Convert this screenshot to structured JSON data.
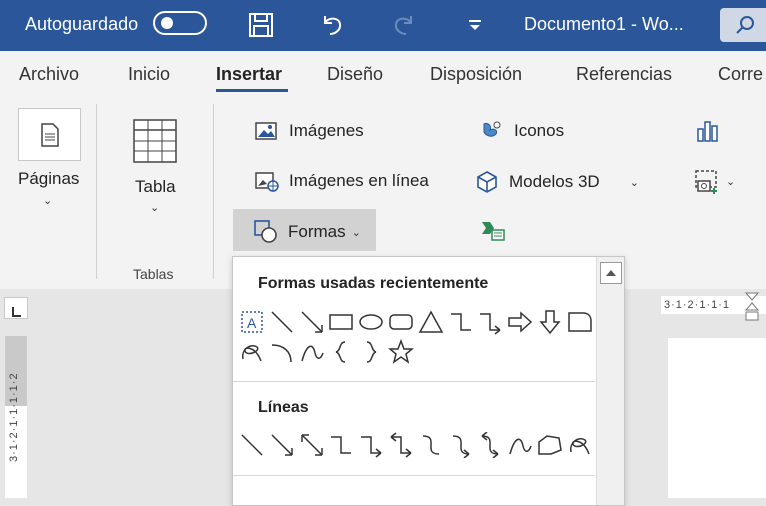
{
  "titlebar": {
    "autosave_label": "Autoguardado",
    "document_title": "Documento1  -  Wo...",
    "icons": [
      "save-icon",
      "undo-icon",
      "redo-icon",
      "customize-quick-access-icon",
      "search-icon"
    ]
  },
  "tabs": [
    {
      "label": "Archivo"
    },
    {
      "label": "Inicio"
    },
    {
      "label": "Insertar",
      "active": true
    },
    {
      "label": "Diseño"
    },
    {
      "label": "Disposición"
    },
    {
      "label": "Referencias"
    },
    {
      "label": "Corre"
    }
  ],
  "ribbon": {
    "paginas": "Páginas",
    "tabla": "Tabla",
    "tablas_group": "Tablas",
    "imagenes": "Imágenes",
    "imagenes_linea": "Imágenes en línea",
    "formas": "Formas",
    "iconos": "Iconos",
    "modelos3d": "Modelos 3D"
  },
  "dropdown": {
    "recent_title": "Formas usadas recientemente",
    "lines_title": "Líneas",
    "recent_shapes": [
      "text-box",
      "line",
      "arrow",
      "rectangle",
      "oval",
      "rounded-rectangle",
      "triangle",
      "elbow-connector",
      "elbow-arrow-connector",
      "right-arrow",
      "down-arrow",
      "snip-corner",
      "freeform-scribble",
      "arc",
      "curve",
      "left-brace",
      "right-brace",
      "star"
    ],
    "line_shapes": [
      "line",
      "arrow",
      "double-arrow",
      "elbow-connector",
      "elbow-arrow-connector",
      "elbow-double-arrow",
      "curved-connector",
      "curved-arrow-connector",
      "curved-double-arrow",
      "curve",
      "freeform",
      "scribble"
    ]
  },
  "rulers": {
    "horizontal": "3·1·2·1·1·1",
    "vertical": "3·1·2·1·1·1·1·2"
  },
  "colors": {
    "titlebar": "#2b579a",
    "accent": "#2b579a",
    "ribbon": "#f3f3f3"
  }
}
